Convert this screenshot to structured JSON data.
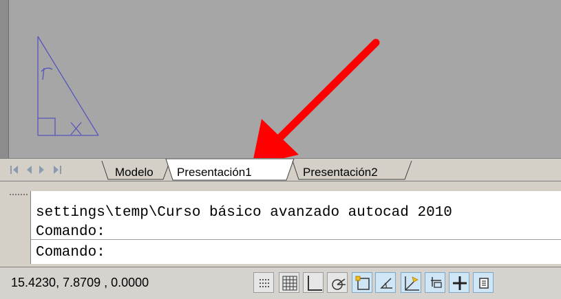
{
  "tabs": {
    "items": [
      {
        "label": "Modelo"
      },
      {
        "label": "Presentación1",
        "active": true
      },
      {
        "label": "Presentación2"
      }
    ],
    "nav_icons": [
      "first-tab-icon",
      "previous-tab-icon",
      "next-tab-icon",
      "last-tab-icon"
    ]
  },
  "command": {
    "history_line": "settings\\temp\\Curso básico avanzado autocad 2010",
    "prompt_line": "Comando:",
    "input_line": "Comando:"
  },
  "status": {
    "coordinates": "15.4230, 7.8709 , 0.0000",
    "toggles": [
      {
        "name": "infer-constraints-icon",
        "on": false
      },
      {
        "name": "grid-icon",
        "on": false
      },
      {
        "name": "ortho-icon",
        "on": false
      },
      {
        "name": "polar-tracking-icon",
        "on": false
      },
      {
        "name": "object-snap-icon",
        "on": true
      },
      {
        "name": "object-snap-tracking-icon",
        "on": true
      },
      {
        "name": "dynamic-ucs-icon",
        "on": true
      },
      {
        "name": "dynamic-input-icon",
        "on": true
      },
      {
        "name": "lineweight-icon",
        "on": true
      },
      {
        "name": "quick-properties-icon",
        "on": true
      }
    ]
  },
  "colors": {
    "drawing_background": "#a6a6a6",
    "sketch_lines": "#5555bb",
    "annotation_arrow": "#ff0000",
    "toggle_on": "#cfe6f6"
  }
}
